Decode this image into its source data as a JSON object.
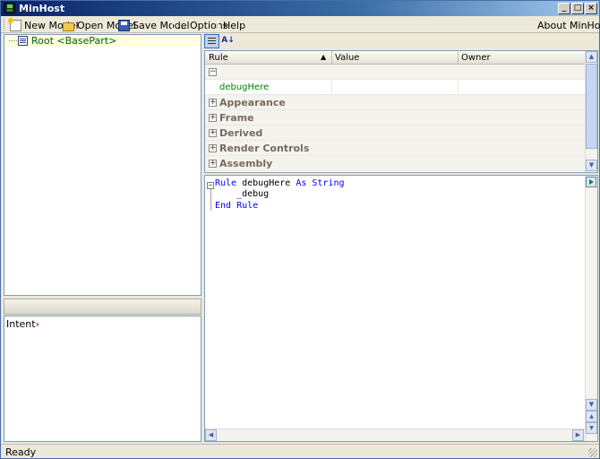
{
  "window": {
    "title": "MinHost"
  },
  "menubar": {
    "new_model": "New Model",
    "open_model": "Open Model",
    "save_model": "Save Model",
    "options": "... Options",
    "help": "Help",
    "about": "About MinHost..."
  },
  "tree": {
    "root_label": "Root <BasePart>"
  },
  "intent": {
    "label": "Intent"
  },
  "grid": {
    "columns": [
      "Rule",
      "Value",
      "Owner"
    ],
    "rule_row": "debugHere",
    "categories": [
      "Appearance",
      "Frame",
      "Derived",
      "Render Controls",
      "Assembly"
    ]
  },
  "code": {
    "line1_kw1": "Rule",
    "line1_name": " debugHere ",
    "line1_kw2": "As String",
    "line2": "    _debug",
    "line3": "End Rule"
  },
  "status": {
    "text": "Ready"
  }
}
